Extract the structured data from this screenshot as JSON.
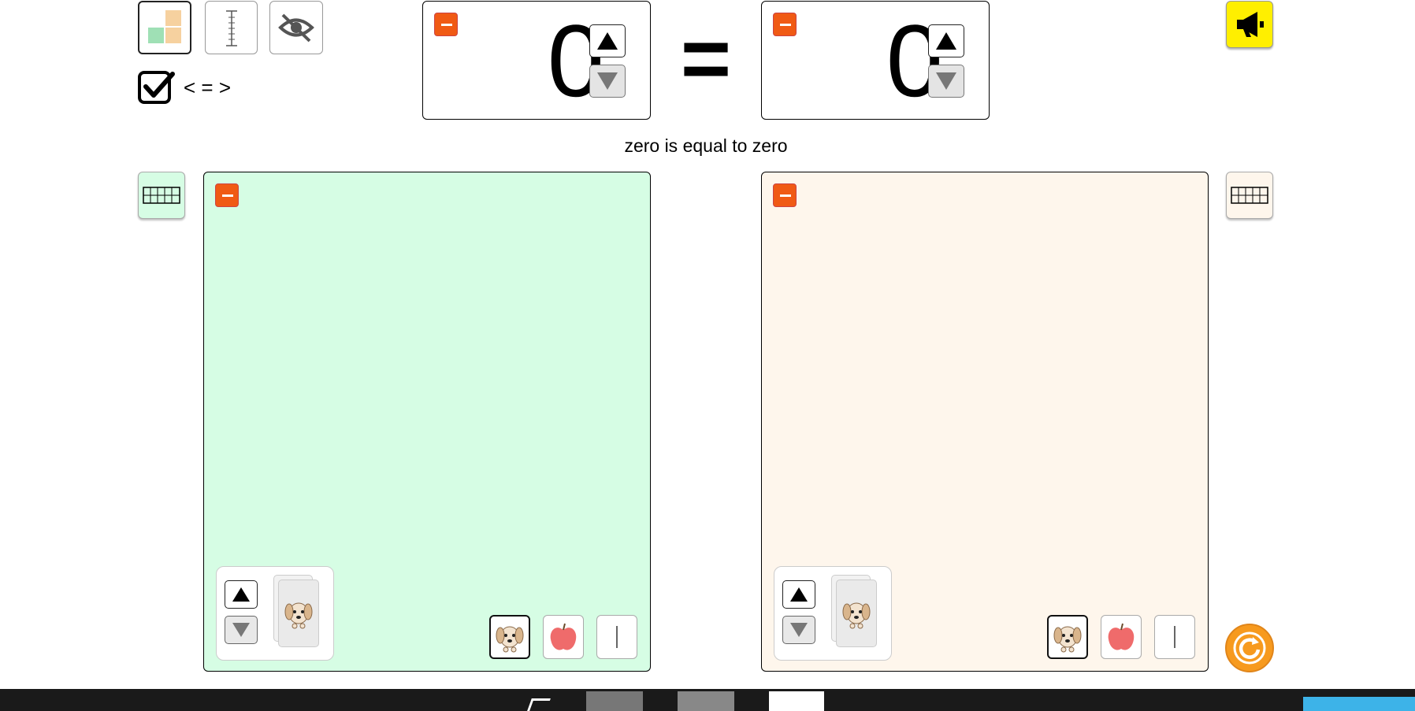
{
  "toolbar": {
    "mode_buttons": [
      {
        "name": "blocks-mode",
        "selected": true
      },
      {
        "name": "numberline-mode",
        "selected": false
      },
      {
        "name": "hide-mode",
        "selected": false
      }
    ],
    "compare_checkbox_checked": true,
    "compare_label": "< = >"
  },
  "left_counter": {
    "value": "0"
  },
  "right_counter": {
    "value": "0"
  },
  "relation_symbol": "=",
  "sentence": "zero is equal to zero",
  "left_panel": {
    "background": "#d6fde4"
  },
  "right_panel": {
    "background": "#fef6ec"
  },
  "colors": {
    "minus": "#f05a14",
    "speaker": "#ffef00",
    "reset": "#f79a1e"
  },
  "icons": [
    "speaker-icon",
    "ten-frame-icon",
    "puppy-icon",
    "apple-icon",
    "tally-icon",
    "reset-icon"
  ]
}
